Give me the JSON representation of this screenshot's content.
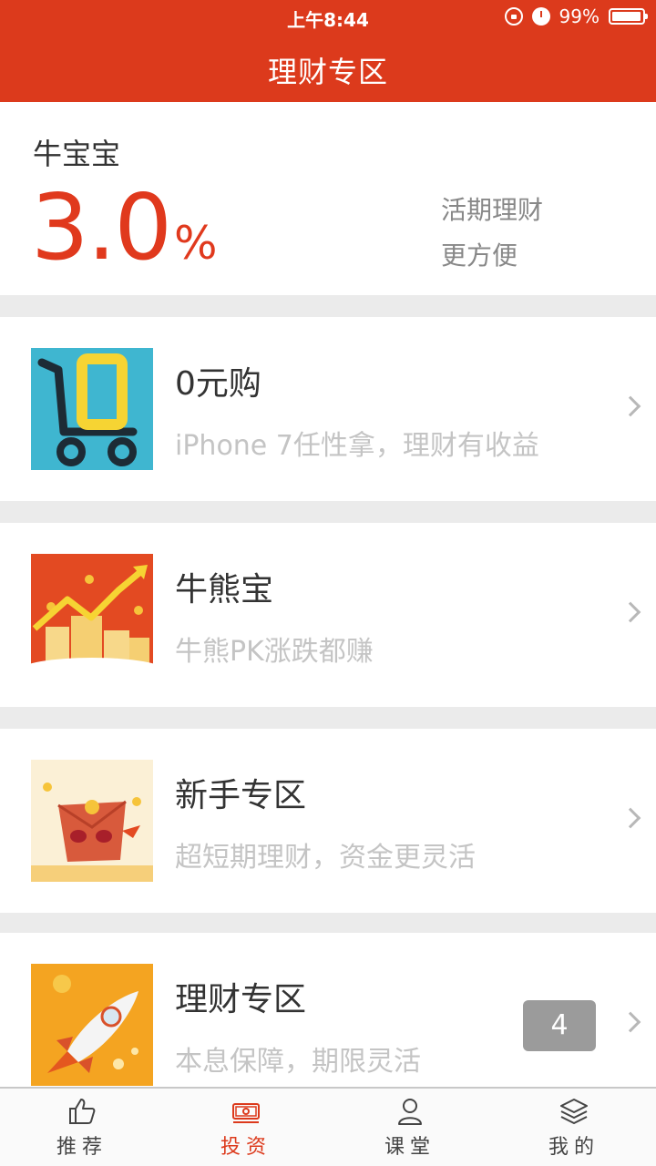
{
  "status_bar": {
    "time": "上午8:44",
    "battery": "99%",
    "battery_level": 0.99
  },
  "header": {
    "title": "理财专区"
  },
  "top_card": {
    "name": "牛宝宝",
    "rate": "3.0",
    "unit": "%",
    "tag_line1": "活期理财",
    "tag_line2": "更方便"
  },
  "products": [
    {
      "name": "0元购",
      "desc": "iPhone 7任性拿，理财有收益",
      "icon": "cart-icon"
    },
    {
      "name": "牛熊宝",
      "desc": "牛熊PK涨跌都赚",
      "icon": "rising-chart-icon"
    },
    {
      "name": "新手专区",
      "desc": "超短期理财，资金更灵活",
      "icon": "red-envelope-icon"
    },
    {
      "name": "理财专区",
      "desc": "本息保障，期限灵活",
      "icon": "rocket-icon",
      "badge": "4"
    }
  ],
  "tabs": [
    {
      "label": "推荐",
      "icon": "thumbs-up-icon"
    },
    {
      "label": "投资",
      "icon": "money-icon",
      "active": true
    },
    {
      "label": "课堂",
      "icon": "person-icon"
    },
    {
      "label": "我的",
      "icon": "layers-icon"
    }
  ],
  "colors": {
    "brand": "#dc3a1c",
    "rate": "#e0391d",
    "badge": "#9b9b9b"
  }
}
